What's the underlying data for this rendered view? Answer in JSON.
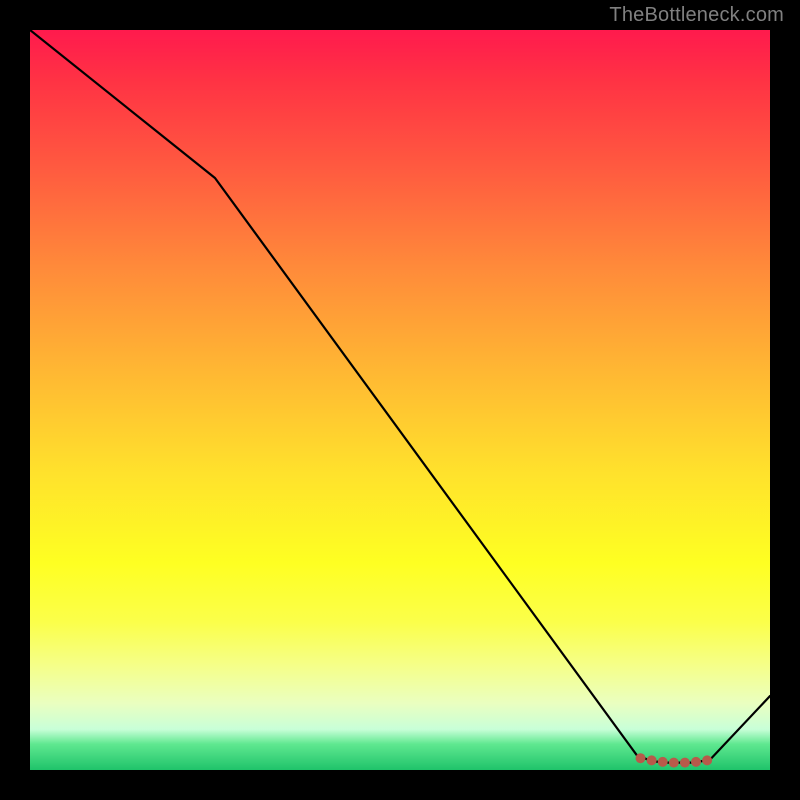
{
  "watermark": "TheBottleneck.com",
  "chart_data": {
    "type": "line",
    "title": "",
    "xlabel": "",
    "ylabel": "",
    "xlim": [
      0,
      100
    ],
    "ylim": [
      0,
      100
    ],
    "series": [
      {
        "name": "curve",
        "x": [
          0,
          25,
          82,
          84,
          86,
          88,
          90,
          92,
          100
        ],
        "values": [
          100,
          80,
          2,
          1.2,
          1.0,
          1.0,
          1.0,
          1.5,
          10
        ]
      }
    ],
    "markers": {
      "x": [
        82.5,
        84,
        85.5,
        87,
        88.5,
        90,
        91.5
      ],
      "values": [
        1.6,
        1.3,
        1.1,
        1.0,
        1.0,
        1.1,
        1.3
      ],
      "color": "#b85a4a",
      "size": 5
    },
    "gradient_stops": [
      {
        "pos": 0.0,
        "color": "#ff1a4d"
      },
      {
        "pos": 0.18,
        "color": "#ff5840"
      },
      {
        "pos": 0.46,
        "color": "#ffb733"
      },
      {
        "pos": 0.72,
        "color": "#feff22"
      },
      {
        "pos": 0.91,
        "color": "#eaffc0"
      },
      {
        "pos": 1.0,
        "color": "#1fc36a"
      }
    ]
  }
}
